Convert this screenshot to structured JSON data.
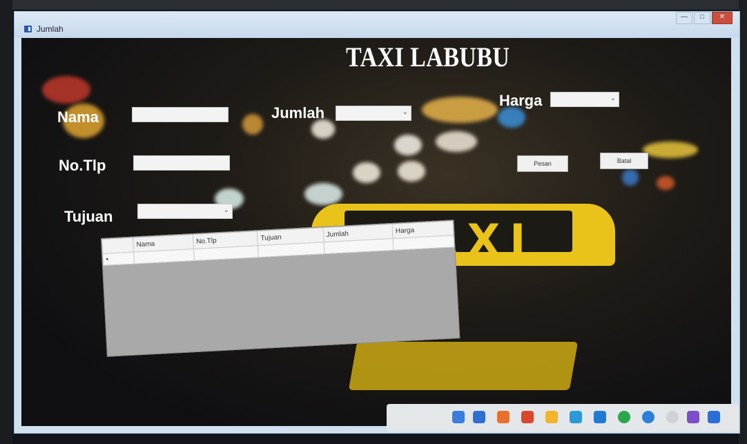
{
  "window": {
    "title": "Jumlah",
    "buttons": [
      "—",
      "□",
      "✕"
    ]
  },
  "app": {
    "title": "TAXI LABUBU"
  },
  "form": {
    "nama_label": "Nama",
    "notlp_label": "No.Tlp",
    "tujuan_label": "Tujuan",
    "jumlah_label": "Jumlah",
    "harga_label": "Harga",
    "nama_value": "",
    "notlp_value": "",
    "tujuan_value": "",
    "jumlah_value": "",
    "harga_value": "",
    "pesan_button": "Pesan",
    "batal_button": "Batal"
  },
  "grid": {
    "columns": [
      "Nama",
      "No.Tlp",
      "Tujuan",
      "Jumlah",
      "Harga"
    ],
    "new_row_marker": "•"
  },
  "sign": {
    "text": "TAXI"
  },
  "icons": [
    "app-window-icon",
    "dropdown-arrow-icon"
  ],
  "colors": {
    "taxi_yellow": "#e9c21a",
    "background": "#1e1a16",
    "titlebar": "#cfe0ef"
  }
}
